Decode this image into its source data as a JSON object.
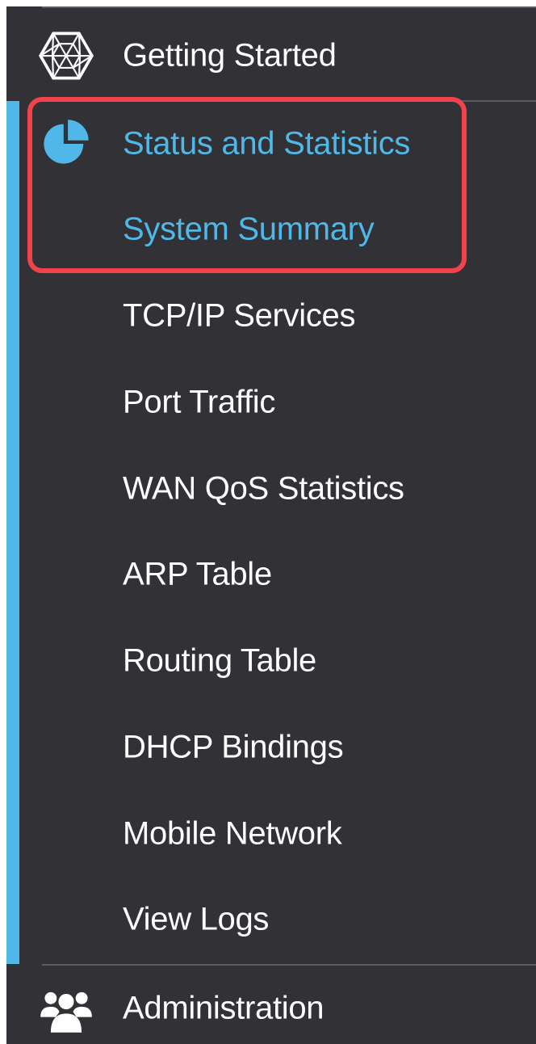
{
  "nav": {
    "getting_started": {
      "label": "Getting Started",
      "icon": "getting-started-icon"
    },
    "status": {
      "label": "Status and Statistics",
      "icon": "pie-chart-icon",
      "expanded": true
    },
    "sub_items": [
      {
        "label": "System Summary",
        "selected": true
      },
      {
        "label": "TCP/IP Services"
      },
      {
        "label": "Port Traffic"
      },
      {
        "label": "WAN QoS Statistics"
      },
      {
        "label": "ARP Table"
      },
      {
        "label": "Routing Table"
      },
      {
        "label": "DHCP Bindings"
      },
      {
        "label": "Mobile Network"
      },
      {
        "label": "View Logs"
      }
    ],
    "administration": {
      "label": "Administration",
      "icon": "users-icon"
    }
  },
  "colors": {
    "sidebar_background": "#323236",
    "text": "#ffffff",
    "accent": "#4fb8e8",
    "highlight_outline": "#f2434d",
    "divider": "#5c5c62"
  }
}
